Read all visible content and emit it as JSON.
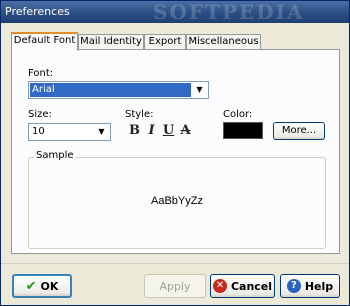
{
  "window": {
    "title": "Preferences",
    "watermark": "SOFTPEDIA"
  },
  "tabs": [
    {
      "label": "Default Font",
      "active": true
    },
    {
      "label": "Mail Identity",
      "active": false
    },
    {
      "label": "Export",
      "active": false
    },
    {
      "label": "Miscellaneous",
      "active": false
    }
  ],
  "font_section": {
    "font_label": "Font:",
    "font_value": "Arial",
    "size_label": "Size:",
    "size_value": "10",
    "style_label": "Style:",
    "style_buttons": [
      "B",
      "I",
      "U",
      "A"
    ],
    "color_label": "Color:",
    "color_value": "#000000",
    "more_button": "More..."
  },
  "sample": {
    "legend": "Sample",
    "text": "AaBbYyZz"
  },
  "buttons": {
    "ok": "OK",
    "apply": "Apply",
    "cancel": "Cancel",
    "help": "Help"
  }
}
